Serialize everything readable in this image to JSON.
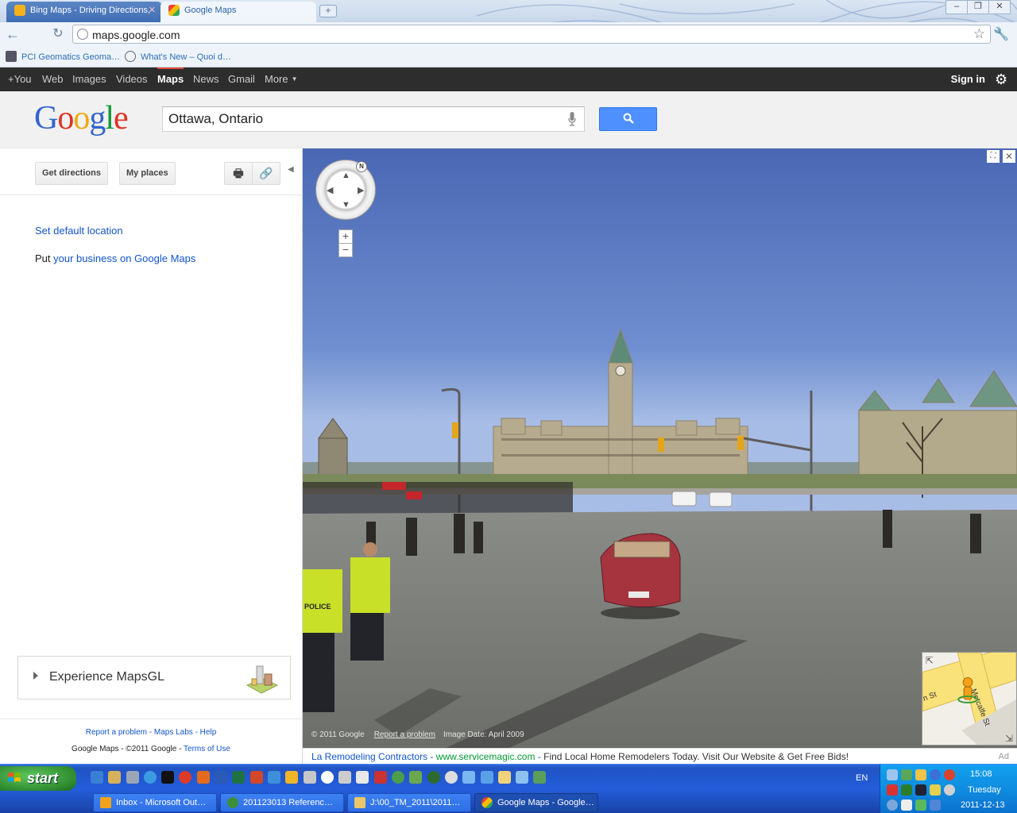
{
  "browser": {
    "tabs": [
      {
        "label": "Bing Maps - Driving Directions,",
        "active": false
      },
      {
        "label": "Google Maps",
        "active": true
      }
    ],
    "new_tab_symbol": "+",
    "window_controls": [
      "–",
      "❐",
      "✕"
    ],
    "url": "maps.google.com",
    "icons": {
      "back": "back-arrow-icon",
      "reload": "reload-icon",
      "site": "globe-icon",
      "bookmark": "star-icon",
      "menu": "wrench-icon"
    },
    "bookmarks": [
      {
        "label": "PCI Geomatics Geoma…"
      },
      {
        "label": "What's New – Quoi d…"
      }
    ]
  },
  "google_bar": {
    "nav": [
      {
        "label": "+You",
        "active": false
      },
      {
        "label": "Web",
        "active": false
      },
      {
        "label": "Images",
        "active": false
      },
      {
        "label": "Videos",
        "active": false
      },
      {
        "label": "Maps",
        "active": true
      },
      {
        "label": "News",
        "active": false
      },
      {
        "label": "Gmail",
        "active": false
      },
      {
        "label": "More",
        "active": false
      }
    ],
    "sign_in": "Sign in",
    "accent_color": "#dd4b39"
  },
  "search": {
    "logo_letters": [
      "G",
      "o",
      "o",
      "g",
      "l",
      "e"
    ],
    "logo_colors": [
      "#3366cc",
      "#dd3322",
      "#eeaa11",
      "#3366cc",
      "#119933",
      "#dd3322"
    ],
    "query": "Ottawa, Ontario",
    "button_color": "#4d90fe"
  },
  "left_panel": {
    "get_directions": "Get directions",
    "my_places": "My places",
    "set_default_location": "Set default location",
    "put_prefix": "Put",
    "put_link": "your business on Google Maps",
    "mapsgl": "Experience MapsGL",
    "footer": {
      "line1": "Report a problem - Maps Labs - Help",
      "line2_prefix": "Google Maps - ©2011 Google -",
      "terms": "Terms of Use"
    }
  },
  "street_view": {
    "copyright": "© 2011 Google",
    "report": "Report a problem",
    "image_date": "Image Date: April 2009",
    "compass_letter": "N",
    "zoom_in": "+",
    "zoom_out": "−",
    "minimap_streets": [
      "n St",
      "Metcalfe St"
    ],
    "sign_labels": [
      "POLICE"
    ]
  },
  "ad": {
    "title": "La Remodeling Contractors",
    "url": "www.servicemagic.com",
    "description": "Find Local Home Remodelers Today. Visit Our Website & Get Free Bids!",
    "label": "Ad"
  },
  "taskbar": {
    "start": "start",
    "tasks": [
      {
        "label": "Inbox - Microsoft Out…"
      },
      {
        "label": "201123013 Referenc…"
      },
      {
        "label": "J:\\00_TM_2011\\2011…"
      },
      {
        "label": "Google Maps - Google…"
      }
    ],
    "language": "EN",
    "clock": {
      "time": "15:08",
      "day": "Tuesday",
      "date": "2011-12-13"
    }
  }
}
